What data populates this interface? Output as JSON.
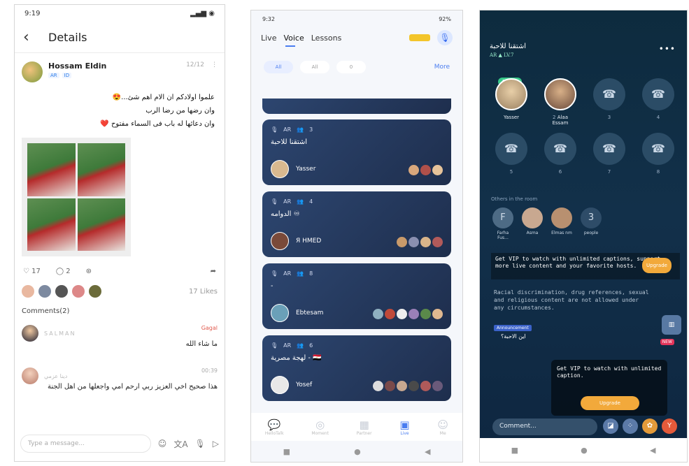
{
  "p1": {
    "status_time": "9:19",
    "header": {
      "title": "Details"
    },
    "post": {
      "author": "Hossam Eldin",
      "chips": [
        "AR",
        "ID"
      ],
      "date": "12/12",
      "lines": [
        "علموا اولادكم ان الام اهم شئ...😍",
        "وان رضها من رضا الرب",
        "وان دعائها له باب فى السماء مفتوح ❤️"
      ],
      "likes_count": "17",
      "comments_count": "2",
      "likes_label": "17 Likes"
    },
    "comments_header": "Comments(2)",
    "comments": [
      {
        "name": "SALMAN",
        "side": "Gagal",
        "text": "ما شاء الله"
      },
      {
        "name": "دينا عزمي",
        "side": "00:39",
        "text": "هذا صحيح اخي العزيز ربي ارحم امي واجعلها من اهل الجنة"
      }
    ],
    "input_placeholder": "Type a message..."
  },
  "p2": {
    "status_time": "9:32",
    "battery": "92%",
    "tabs": [
      "Live",
      "Voice",
      "Lessons"
    ],
    "filters": [
      "All",
      "All",
      "0"
    ],
    "more_label": "More",
    "rooms": [
      {
        "lang": "AR",
        "count": "3",
        "title": "اشتقنا للاحبة",
        "host": "Yasser"
      },
      {
        "lang": "AR",
        "count": "4",
        "title": "الدوامه ♾",
        "host": "Я HMED"
      },
      {
        "lang": "AR",
        "count": "8",
        "title": "-",
        "host": "Ebtesam"
      },
      {
        "lang": "AR",
        "count": "6",
        "title": "لهجة مصرية - 🇪🇬",
        "host": "Yosef"
      }
    ],
    "nav": [
      "HelloTalk",
      "Moment",
      "Partner",
      "Live",
      "Me"
    ]
  },
  "p3": {
    "room_title": "اشتقنا للاحبة",
    "room_sub": "AR  ▲ LV.7",
    "follow": "Follow",
    "seats": [
      {
        "num": "",
        "name": "Yasser"
      },
      {
        "num": "2",
        "name": "Alaa Essam"
      },
      {
        "num": "3",
        "name": ""
      },
      {
        "num": "4",
        "name": ""
      },
      {
        "num": "5",
        "name": ""
      },
      {
        "num": "6",
        "name": ""
      },
      {
        "num": "7",
        "name": ""
      },
      {
        "num": "8",
        "name": ""
      }
    ],
    "others_label": "Others in the room",
    "others": [
      {
        "initial": "F",
        "name": "Farha Fus..."
      },
      {
        "initial": "",
        "name": "Asma"
      },
      {
        "initial": "",
        "name": "Elmas nm"
      },
      {
        "initial": "3",
        "name": "people"
      }
    ],
    "vip_banner": "Get VIP to watch with unlimited captions, support more live content and your favorite hosts.",
    "upgrade": "Upgrade",
    "rules": "Racial discrimination, drug references, sexual and religious content are not allowed under any circumstances.",
    "announcement": "Announcement",
    "announce_text": "این الاحبة؟",
    "new_badge": "NEW",
    "vip_popup": "Get VIP to watch with unlimited caption.",
    "comment_placeholder": "Comment..."
  }
}
